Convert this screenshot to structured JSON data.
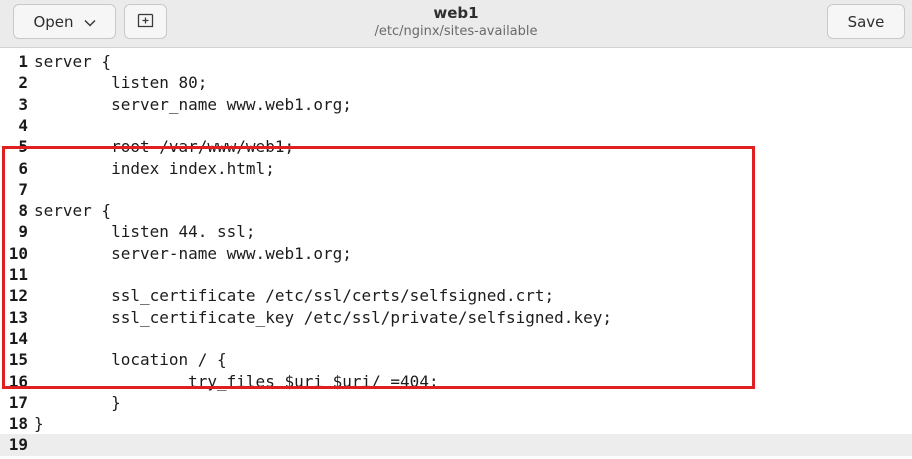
{
  "header": {
    "open_label": "Open",
    "save_label": "Save",
    "title": "web1",
    "subtitle": "/etc/nginx/sites-available"
  },
  "editor": {
    "current_line": 19,
    "lines": [
      {
        "num": "1",
        "text": "server {"
      },
      {
        "num": "2",
        "text": "        listen 80;"
      },
      {
        "num": "3",
        "text": "        server_name www.web1.org;"
      },
      {
        "num": "4",
        "text": ""
      },
      {
        "num": "5",
        "text": "        root /var/www/web1;"
      },
      {
        "num": "6",
        "text": "        index index.html;"
      },
      {
        "num": "7",
        "text": ""
      },
      {
        "num": "8",
        "text": "server {"
      },
      {
        "num": "9",
        "text": "        listen 44. ssl;"
      },
      {
        "num": "10",
        "text": "        server-name www.web1.org;"
      },
      {
        "num": "11",
        "text": ""
      },
      {
        "num": "12",
        "text": "        ssl_certificate /etc/ssl/certs/selfsigned.crt;"
      },
      {
        "num": "13",
        "text": "        ssl_certificate_key /etc/ssl/private/selfsigned.key;"
      },
      {
        "num": "14",
        "text": ""
      },
      {
        "num": "15",
        "text": "        location / {"
      },
      {
        "num": "16",
        "text": "                try_files $uri $uri/ =404;"
      },
      {
        "num": "17",
        "text": "        }"
      },
      {
        "num": "18",
        "text": "}"
      },
      {
        "num": "19",
        "text": ""
      }
    ]
  },
  "colors": {
    "highlight_border": "#e02020",
    "current_line_bg": "#ededed",
    "headerbar_bg": "#ebebeb"
  },
  "icons": {
    "open_dropdown": "chevron-down-icon",
    "new_tab": "new-tab-icon"
  }
}
